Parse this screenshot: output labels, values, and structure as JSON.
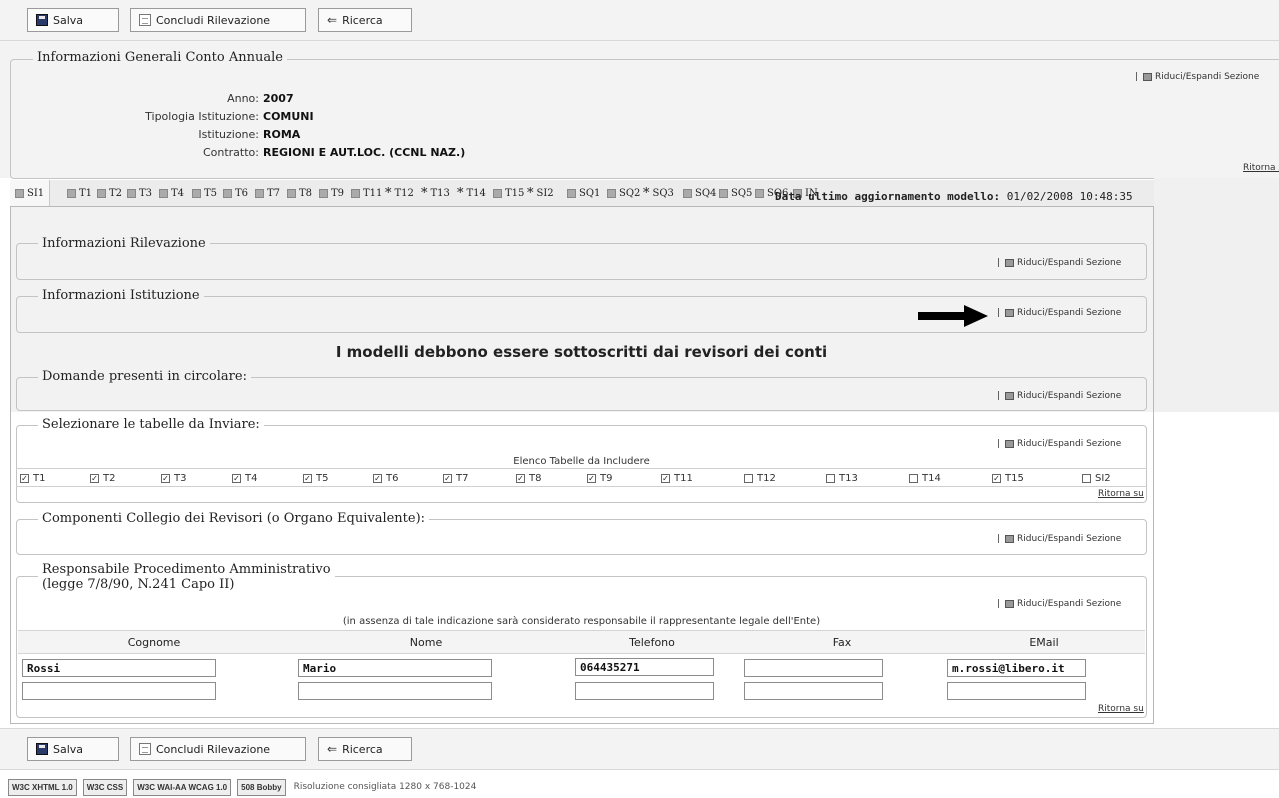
{
  "toolbar": {
    "save_label": "Salva",
    "conclude_label": "Concludi Rilevazione",
    "search_label": "Ricerca"
  },
  "general_info": {
    "title": "Informazioni Generali Conto Annuale",
    "toggle_label": "Riduci/Espandi Sezione",
    "back_top": "Ritorna su",
    "fields": [
      {
        "label": "Anno:",
        "value": "2007"
      },
      {
        "label": "Tipologia Istituzione:",
        "value": "COMUNI"
      },
      {
        "label": "Istituzione:",
        "value": "ROMA"
      },
      {
        "label": "Contratto:",
        "value": "REGIONI E AUT.LOC. (CCNL NAZ.)"
      }
    ]
  },
  "tabs": [
    {
      "label": "SI1",
      "mark": "square",
      "active": true
    },
    {
      "label": "T1",
      "mark": "square"
    },
    {
      "label": "T2",
      "mark": "square"
    },
    {
      "label": "T3",
      "mark": "square"
    },
    {
      "label": "T4",
      "mark": "square"
    },
    {
      "label": "T5",
      "mark": "square"
    },
    {
      "label": "T6",
      "mark": "square"
    },
    {
      "label": "T7",
      "mark": "square"
    },
    {
      "label": "T8",
      "mark": "square"
    },
    {
      "label": "T9",
      "mark": "square"
    },
    {
      "label": "T11",
      "mark": "square"
    },
    {
      "label": "T12",
      "mark": "star"
    },
    {
      "label": "T13",
      "mark": "star"
    },
    {
      "label": "T14",
      "mark": "star"
    },
    {
      "label": "T15",
      "mark": "square"
    },
    {
      "label": "SI2",
      "mark": "star"
    },
    {
      "label": "SQ1",
      "mark": "square"
    },
    {
      "label": "SQ2",
      "mark": "square"
    },
    {
      "label": "SQ3",
      "mark": "star"
    },
    {
      "label": "SQ4",
      "mark": "square"
    },
    {
      "label": "SQ5",
      "mark": "square"
    },
    {
      "label": "SQ6",
      "mark": "square"
    },
    {
      "label": "IN",
      "mark": "square"
    }
  ],
  "update": {
    "label": "Data ultimo aggiornamento modello:",
    "value": "01/02/2008 10:48:35"
  },
  "sections": {
    "rilevazione": "Informazioni Rilevazione",
    "istituzione": "Informazioni Istituzione",
    "notice": "I modelli debbono essere sottoscritti dai revisori dei conti",
    "domande": "Domande presenti in circolare:",
    "selezionare": "Selezionare le tabelle da Inviare:",
    "elenco": "Elenco Tabelle da Includere",
    "collegio": "Componenti Collegio dei Revisori (o Organo Equivalente):",
    "responsabile_1": "Responsabile Procedimento Amministrativo",
    "responsabile_2": "(legge 7/8/90, N.241 Capo II)",
    "responsabile_note": "(in assenza di tale indicazione sarà considerato responsabile il rappresentante legale dell'Ente)",
    "toggle_label": "Riduci/Espandi Sezione",
    "back_top": "Ritorna su"
  },
  "tables_checklist": [
    {
      "label": "T1",
      "checked": true
    },
    {
      "label": "T2",
      "checked": true
    },
    {
      "label": "T3",
      "checked": true
    },
    {
      "label": "T4",
      "checked": true
    },
    {
      "label": "T5",
      "checked": true
    },
    {
      "label": "T6",
      "checked": true
    },
    {
      "label": "T7",
      "checked": true
    },
    {
      "label": "T8",
      "checked": true
    },
    {
      "label": "T9",
      "checked": true
    },
    {
      "label": "T11",
      "checked": true
    },
    {
      "label": "T12",
      "checked": false
    },
    {
      "label": "T13",
      "checked": false
    },
    {
      "label": "T14",
      "checked": false
    },
    {
      "label": "T15",
      "checked": true
    },
    {
      "label": "SI2",
      "checked": false
    }
  ],
  "contact_table": {
    "headers": [
      "Cognome",
      "Nome",
      "Telefono",
      "Fax",
      "EMail"
    ],
    "rows": [
      [
        "Rossi",
        "Mario",
        "064435271",
        "",
        "m.rossi@libero.it"
      ],
      [
        "",
        "",
        "",
        "",
        ""
      ]
    ]
  },
  "footer": {
    "badges": [
      "W3C XHTML 1.0",
      "W3C CSS",
      "W3C WAI-AA WCAG 1.0",
      "508 Bobby"
    ],
    "resolution_text": "Risoluzione consigliata 1280 x 768-1024"
  }
}
